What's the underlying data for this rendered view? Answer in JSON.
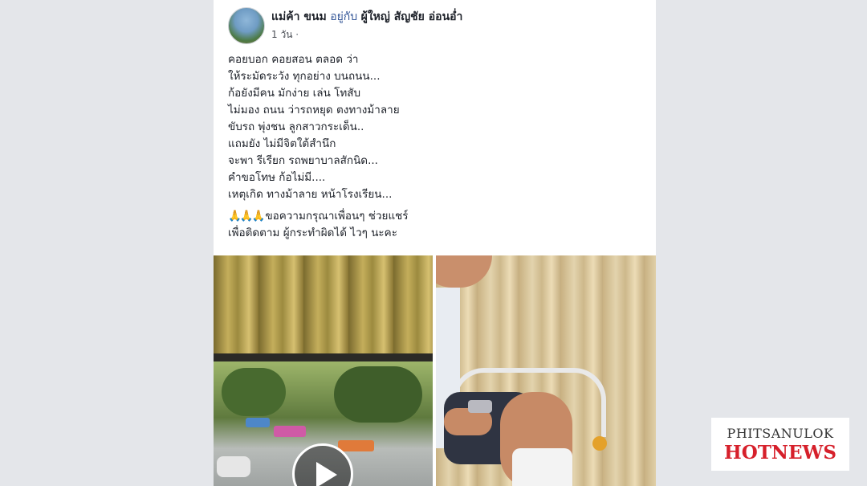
{
  "post": {
    "author": "แม่ค้า ขนม",
    "with_word": "อยู่กับ",
    "tagged": "ผู้ใหญ่ สัญชัย อ่อนอ่ำ",
    "time": "1 วัน",
    "time_sep": "·",
    "lines": [
      "คอยบอก คอยสอน ตลอด ว่า",
      "ให้ระมัดระวัง ทุกอย่าง บนถนน...",
      "ก้อยังมีคน มักง่าย เล่น โทสับ",
      "ไม่มอง ถนน ว่ารถหยุด ตงทางม้าลาย",
      "ขับรถ พุ่งชน ลูกสาวกระเด็น..",
      "แถมยัง ไม่มีจิตใต้สำนึก",
      "จะพา รีเรียก รถพยาบาลสักนิด...",
      "คำขอโทษ ก้อไม่มี....",
      "เหตุเกิด ทางม้าลาย หน้าโรงเรียน..."
    ],
    "emoji": "🙏🙏🙏",
    "share_line1": "ขอความกรุณาเพื่อนๆ ช่วยแชร์",
    "share_line2": "เพื่อติดตาม ผู้กระทำผิดได้ ไวๆ นะคะ"
  },
  "watermark": {
    "line1": "PHITSANULOK",
    "line2": "HOTNEWS"
  },
  "colors": {
    "link": "#365899",
    "brand_red": "#d6202b"
  }
}
